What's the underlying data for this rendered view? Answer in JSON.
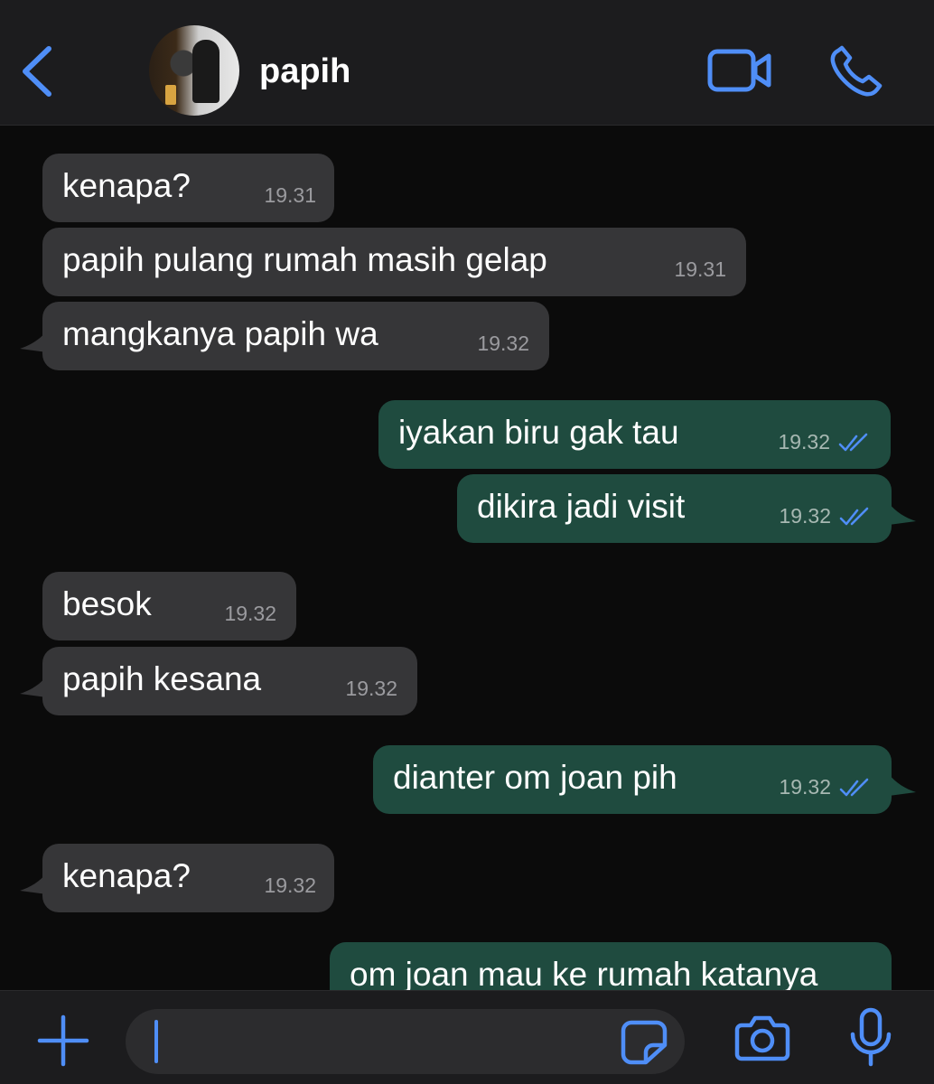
{
  "header": {
    "contact_name": "papih",
    "icons": [
      "chevron-left-icon",
      "video-camera-icon",
      "phone-icon"
    ],
    "accent_color": "#4f8ef7"
  },
  "messages": [
    {
      "direction": "in",
      "text": "kenapa?",
      "time": "19.31"
    },
    {
      "direction": "in",
      "text": "papih pulang rumah masih gelap",
      "time": "19.31"
    },
    {
      "direction": "in",
      "text": "mangkanya papih wa",
      "time": "19.32"
    },
    {
      "direction": "out",
      "text": "iyakan biru gak tau",
      "time": "19.32",
      "status": "read"
    },
    {
      "direction": "out",
      "text": "dikira jadi visit",
      "time": "19.32",
      "status": "read"
    },
    {
      "direction": "in",
      "text": "besok",
      "time": "19.32"
    },
    {
      "direction": "in",
      "text": "papih kesana",
      "time": "19.32"
    },
    {
      "direction": "out",
      "text": "dianter om joan pih",
      "time": "19.32",
      "status": "read"
    },
    {
      "direction": "in",
      "text": "kenapa?",
      "time": "19.32"
    },
    {
      "direction": "out",
      "text": "om joan mau ke rumah katanya",
      "time": ""
    }
  ],
  "input": {
    "placeholder": "",
    "icons": [
      "plus-icon",
      "sticker-icon",
      "camera-icon",
      "microphone-icon"
    ]
  },
  "colors": {
    "incoming_bubble": "#363638",
    "outgoing_bubble": "#1f4b3f",
    "read_ticks": "#4f8ef7"
  }
}
